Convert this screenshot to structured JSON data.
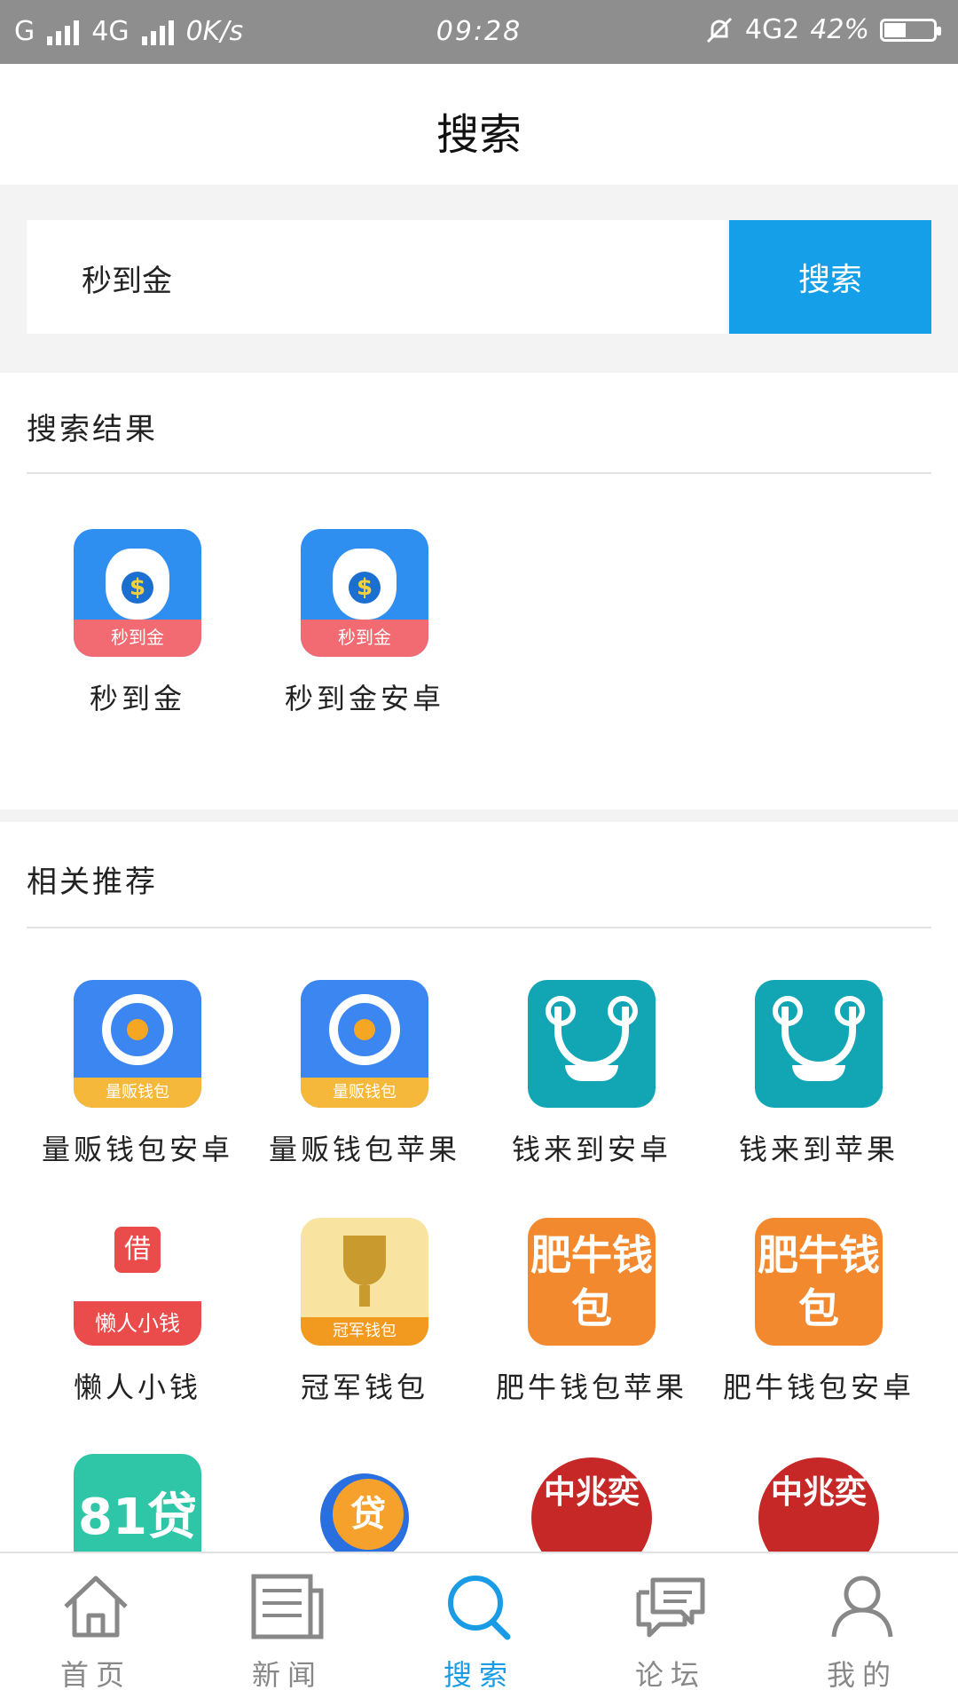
{
  "status_bar": {
    "carrier1": "G",
    "carrier2": "4G",
    "speed": "0K/s",
    "time": "09:28",
    "network2": "4G2",
    "battery": "42%",
    "battery_level": 0.42
  },
  "header": {
    "title": "搜索"
  },
  "search": {
    "value": "秒到金",
    "button_label": "搜索"
  },
  "results": {
    "title": "搜索结果",
    "items": [
      {
        "label": "秒到金",
        "icon": "money-bag-icon",
        "badge": "秒到金"
      },
      {
        "label": "秒到金安卓",
        "icon": "money-bag-icon",
        "badge": "秒到金"
      }
    ]
  },
  "recommend": {
    "title": "相关推荐",
    "items": [
      {
        "label": "量贩钱包安卓",
        "icon": "swirl-icon",
        "badge": "量贩钱包"
      },
      {
        "label": "量贩钱包苹果",
        "icon": "swirl-icon",
        "badge": "量贩钱包"
      },
      {
        "label": "钱来到安卓",
        "icon": "mustache-face-icon"
      },
      {
        "label": "钱来到苹果",
        "icon": "mustache-face-icon"
      },
      {
        "label": "懒人小钱",
        "icon": "borrow-seal-icon",
        "badge": "懒人小钱",
        "mark": "借"
      },
      {
        "label": "冠军钱包",
        "icon": "trophy-icon",
        "badge": "冠军钱包"
      },
      {
        "label": "肥牛钱包苹果",
        "icon": "text-logo-icon",
        "logo_text": "肥牛钱包"
      },
      {
        "label": "肥牛钱包安卓",
        "icon": "text-logo-icon",
        "logo_text": "肥牛钱包"
      },
      {
        "icon": "81-dai-icon",
        "logo_text": "81贷"
      },
      {
        "icon": "dai-circle-icon",
        "logo_text": "贷"
      },
      {
        "icon": "zhaoyi-seal-icon",
        "logo_text": "中兆奕"
      },
      {
        "icon": "zhaoyi-seal-icon",
        "logo_text": "中兆奕"
      }
    ]
  },
  "tabbar": {
    "items": [
      {
        "label": "首页",
        "icon": "home-icon",
        "active": false
      },
      {
        "label": "新闻",
        "icon": "news-icon",
        "active": false
      },
      {
        "label": "搜索",
        "icon": "search-icon",
        "active": true
      },
      {
        "label": "论坛",
        "icon": "chat-icon",
        "active": false
      },
      {
        "label": "我的",
        "icon": "user-icon",
        "active": false
      }
    ]
  },
  "colors": {
    "accent": "#149fe8",
    "tab_active": "#1a9be6",
    "status_bar": "#8e8e8e"
  }
}
